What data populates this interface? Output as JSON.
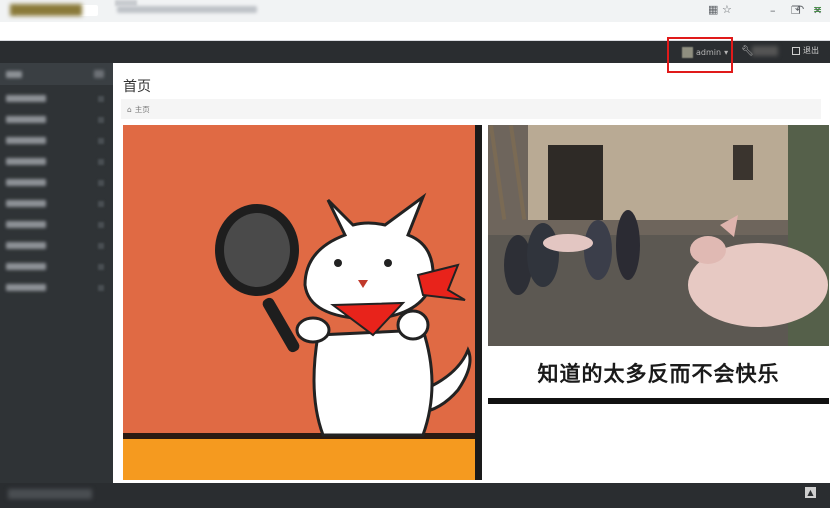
{
  "browser": {
    "window_buttons": [
      "–",
      "❐",
      "✕"
    ],
    "address_icons": [
      "qr-icon",
      "star-icon"
    ],
    "toolbar_icons": [
      "back-icon",
      "extension-icon"
    ]
  },
  "header": {
    "username": "admin",
    "user_menu_arrow": "▾",
    "tool_glyph": "🔧",
    "logout_label": "退出"
  },
  "page": {
    "title": "首页",
    "breadcrumb_home": "主页",
    "home_glyph": "⌂"
  },
  "content": {
    "meme_caption": "知道的太多反而不会快乐"
  },
  "colors": {
    "accent_highlight": "#e01a1a",
    "appbar": "#2a2d30",
    "sidebar": "#2f3336",
    "meme_bg": "#e06a44"
  }
}
